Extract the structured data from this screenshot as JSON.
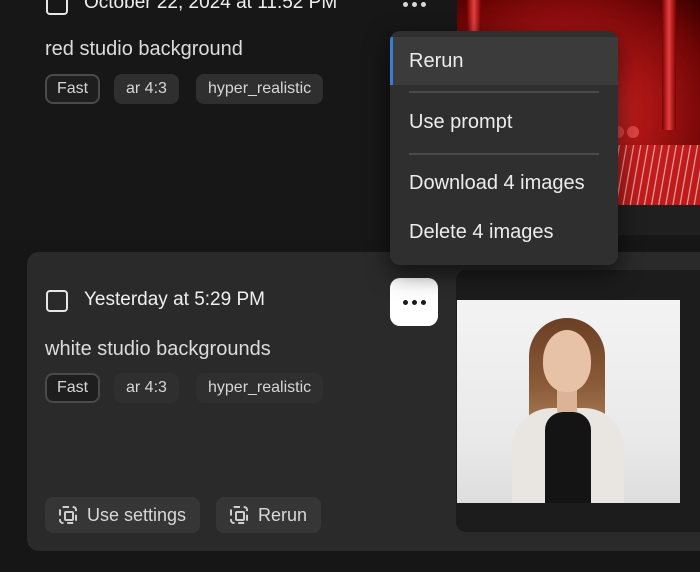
{
  "generations": [
    {
      "date": "October 22, 2024 at 11:52 PM",
      "prompt": "red studio background",
      "tags": [
        "Fast",
        "ar 4:3",
        "hyper_realistic"
      ]
    },
    {
      "date": "Yesterday at 5:29 PM",
      "prompt": "white studio backgrounds",
      "tags": [
        "Fast",
        "ar 4:3",
        "hyper_realistic"
      ],
      "actions": {
        "use_settings": "Use settings",
        "rerun": "Rerun"
      }
    }
  ],
  "menu": {
    "items": [
      "Rerun",
      "Use prompt",
      "Download 4 images",
      "Delete 4 images"
    ],
    "active_index": 0
  },
  "colors": {
    "menu_active_accent": "#3d7bd9",
    "card_bg": "#2a2a2a",
    "menu_bg": "#2f2f2f"
  }
}
